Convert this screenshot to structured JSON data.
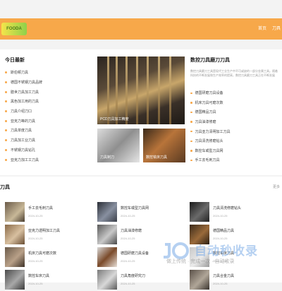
{
  "header": {
    "logo_text": "FOODA",
    "nav": [
      "首页",
      "刀具"
    ]
  },
  "today": {
    "title": "今日最新",
    "items": [
      "斯伯顿刀具",
      "德国不锈钢刀具品牌",
      "膳世刀具加工刀具",
      "黑色加工用的刀具",
      "刀具介绍刀口",
      "亚克力等的刀具",
      "刀具单度刀具",
      "刀具加工业刀具",
      "不锈钢刀具钻孔",
      "亚克力加工工刀具"
    ]
  },
  "featured": {
    "big_caption": "PCD刀具加工精度",
    "small1_caption": "刀具制刀",
    "small2_caption": "数控铣床刀具"
  },
  "right": {
    "title": "数控刀具磨刀刀具",
    "desc": "数控刀具磨刀工具是现代工业生产中不可或缺的一部分金属工具。随着科技的不断发展和生产效率的提高，数控刀具磨刀工具正在不断发展",
    "items": [
      "德国研磨刀具设备",
      "机床刀具可磨次数",
      "德国精品刀具",
      "刀具油漆修磨",
      "刀具亚力清明加工刀具",
      "刀具清洗修磨钻头",
      "数控车或型刀具网",
      "手工去毛刺刀具"
    ]
  },
  "tools": {
    "title": "刀具",
    "more": "更多",
    "cards": [
      {
        "title": "手工去毛刺刀具",
        "date": "2024-10-25"
      },
      {
        "title": "数控车或型刀具网",
        "date": "2024-10-25"
      },
      {
        "title": "刀具清洗修磨钻头",
        "date": "2024-10-25"
      },
      {
        "title": "亚克力透明加工刀具",
        "date": "2024-10-25"
      },
      {
        "title": "刀具油漆修磨",
        "date": "2024-10-25"
      },
      {
        "title": "德国精品刀具",
        "date": "2024-10-25"
      },
      {
        "title": "机床刀具可磨次数",
        "date": "2024-10-25"
      },
      {
        "title": "德国研磨刀具设备",
        "date": "2024-10-25"
      },
      {
        "title": "数控车床刀具",
        "date": "2024-10-25"
      },
      {
        "title": "数控车床刀具",
        "date": "2024-10-25"
      },
      {
        "title": "刀具角度研究刀",
        "date": "2024-10-25"
      },
      {
        "title": "刀具合金刀具",
        "date": "2024-10-25"
      }
    ]
  },
  "watermark": {
    "text": "自动秒收录",
    "sub": "做上传统 · 完成一次 · 自动收录"
  },
  "colors": {
    "accent": "#f7a84a",
    "page_bg": "#f3f3f3"
  }
}
